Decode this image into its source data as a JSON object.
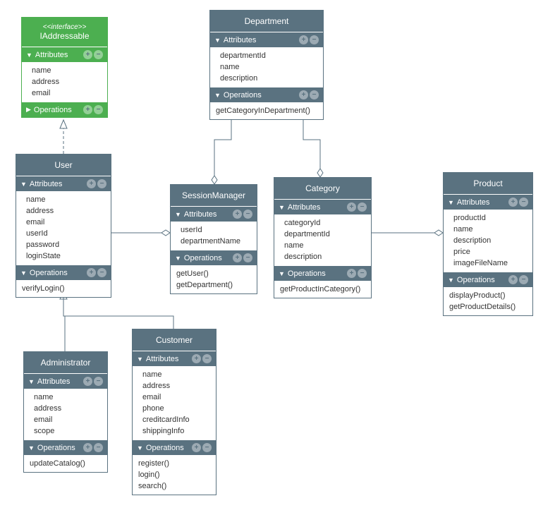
{
  "diagram": {
    "type": "uml-class-diagram"
  },
  "interface": {
    "stereotype": "<<interface>>",
    "name": "IAddressable",
    "attributesLabel": "Attributes",
    "attributes": [
      "name",
      "address",
      "email"
    ],
    "operationsLabel": "Operations"
  },
  "department": {
    "name": "Department",
    "attributesLabel": "Attributes",
    "attributes": [
      "departmentId",
      "name",
      "description"
    ],
    "operationsLabel": "Operations",
    "operations": [
      "getCategoryInDepartment()"
    ]
  },
  "user": {
    "name": "User",
    "attributesLabel": "Attributes",
    "attributes": [
      "name",
      "address",
      "email",
      "userId",
      "password",
      "loginState"
    ],
    "operationsLabel": "Operations",
    "operations": [
      "verifyLogin()"
    ]
  },
  "sessionManager": {
    "name": "SessionManager",
    "attributesLabel": "Attributes",
    "attributes": [
      "userId",
      "departmentName"
    ],
    "operationsLabel": "Operations",
    "operations": [
      "getUser()",
      "getDepartment()"
    ]
  },
  "category": {
    "name": "Category",
    "attributesLabel": "Attributes",
    "attributes": [
      "categoryId",
      "departmentId",
      "name",
      "description"
    ],
    "operationsLabel": "Operations",
    "operations": [
      "getProductInCategory()"
    ]
  },
  "product": {
    "name": "Product",
    "attributesLabel": "Attributes",
    "attributes": [
      "productId",
      "name",
      "description",
      "price",
      "imageFileName"
    ],
    "operationsLabel": "Operations",
    "operations": [
      "displayProduct()",
      "getProductDetails()"
    ]
  },
  "administrator": {
    "name": "Administrator",
    "attributesLabel": "Attributes",
    "attributes": [
      "name",
      "address",
      "email",
      "scope"
    ],
    "operationsLabel": "Operations",
    "operations": [
      "updateCatalog()"
    ]
  },
  "customer": {
    "name": "Customer",
    "attributesLabel": "Attributes",
    "attributes": [
      "name",
      "address",
      "email",
      "phone",
      "creditcardInfo",
      "shippingInfo"
    ],
    "operationsLabel": "Operations",
    "operations": [
      "register()",
      "login()",
      "search()"
    ]
  },
  "icons": {
    "plus": "+",
    "minus": "−",
    "down": "▼",
    "right": "▶"
  },
  "chart_data": {
    "type": "uml-class-diagram",
    "nodes": [
      {
        "id": "IAddressable",
        "kind": "interface",
        "attributes": [
          "name",
          "address",
          "email"
        ],
        "operations": []
      },
      {
        "id": "Department",
        "kind": "class",
        "attributes": [
          "departmentId",
          "name",
          "description"
        ],
        "operations": [
          "getCategoryInDepartment()"
        ]
      },
      {
        "id": "User",
        "kind": "class",
        "attributes": [
          "name",
          "address",
          "email",
          "userId",
          "password",
          "loginState"
        ],
        "operations": [
          "verifyLogin()"
        ]
      },
      {
        "id": "SessionManager",
        "kind": "class",
        "attributes": [
          "userId",
          "departmentName"
        ],
        "operations": [
          "getUser()",
          "getDepartment()"
        ]
      },
      {
        "id": "Category",
        "kind": "class",
        "attributes": [
          "categoryId",
          "departmentId",
          "name",
          "description"
        ],
        "operations": [
          "getProductInCategory()"
        ]
      },
      {
        "id": "Product",
        "kind": "class",
        "attributes": [
          "productId",
          "name",
          "description",
          "price",
          "imageFileName"
        ],
        "operations": [
          "displayProduct()",
          "getProductDetails()"
        ]
      },
      {
        "id": "Administrator",
        "kind": "class",
        "attributes": [
          "name",
          "address",
          "email",
          "scope"
        ],
        "operations": [
          "updateCatalog()"
        ]
      },
      {
        "id": "Customer",
        "kind": "class",
        "attributes": [
          "name",
          "address",
          "email",
          "phone",
          "creditcardInfo",
          "shippingInfo"
        ],
        "operations": [
          "register()",
          "login()",
          "search()"
        ]
      }
    ],
    "edges": [
      {
        "from": "User",
        "to": "IAddressable",
        "type": "realization"
      },
      {
        "from": "Administrator",
        "to": "User",
        "type": "generalization"
      },
      {
        "from": "Customer",
        "to": "User",
        "type": "generalization"
      },
      {
        "from": "SessionManager",
        "to": "User",
        "type": "aggregation"
      },
      {
        "from": "SessionManager",
        "to": "Department",
        "type": "aggregation"
      },
      {
        "from": "Category",
        "to": "Department",
        "type": "aggregation"
      },
      {
        "from": "Product",
        "to": "Category",
        "type": "aggregation"
      }
    ]
  }
}
